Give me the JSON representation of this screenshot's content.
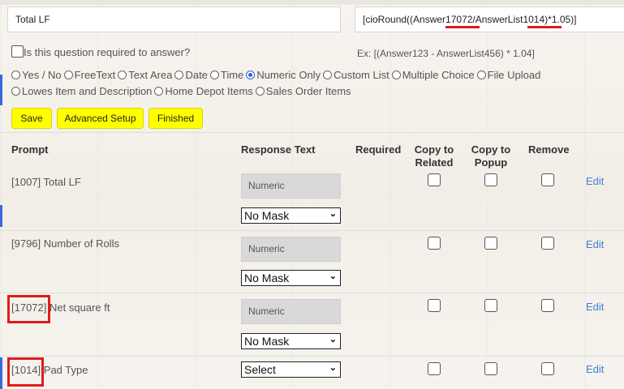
{
  "prompt_field": {
    "value": "Total LF"
  },
  "formula_field": {
    "parts": [
      "[cioRound((Answer",
      "17072",
      "/AnswerList",
      "1014)",
      "*1.05)]"
    ]
  },
  "required_label": "Is this question required to answer?",
  "example_text": "Ex: [(Answer123 - AnswerList456) * 1.04]",
  "answer_types": {
    "selected": "Numeric Only",
    "line1": [
      "Yes / No",
      "FreeText",
      "Text Area",
      "Date",
      "Time",
      "Numeric Only",
      "Custom List",
      "Multiple Choice",
      "File Upload"
    ],
    "line2": [
      "Lowes Item and Description",
      "Home Depot Items",
      "Sales Order Items"
    ]
  },
  "buttons": {
    "save": "Save",
    "advanced": "Advanced Setup",
    "finished": "Finished"
  },
  "table": {
    "headers": {
      "prompt": "Prompt",
      "response": "Response Text",
      "required": "Required",
      "copy_related": "Copy to Related",
      "copy_popup": "Copy to Popup",
      "remove": "Remove"
    },
    "rows": [
      {
        "id": "[1007]",
        "label": "Total LF",
        "response_placeholder": "Numeric",
        "select": "No Mask",
        "edit": "Edit"
      },
      {
        "id": "[9796]",
        "label": "Number of Rolls",
        "response_placeholder": "Numeric",
        "select": "No Mask",
        "edit": "Edit"
      },
      {
        "id": "[17072]",
        "label": "Net square ft",
        "response_placeholder": "Numeric",
        "select": "No Mask",
        "edit": "Edit"
      },
      {
        "id": "[1014]",
        "label": "Pad Type",
        "select": "Select",
        "edit": "Edit"
      }
    ]
  },
  "colors": {
    "highlight_button": "#ffff00",
    "annotation_red": "#e01b1b",
    "link_blue": "#3d7fd6",
    "radio_blue": "#2e62d6"
  }
}
